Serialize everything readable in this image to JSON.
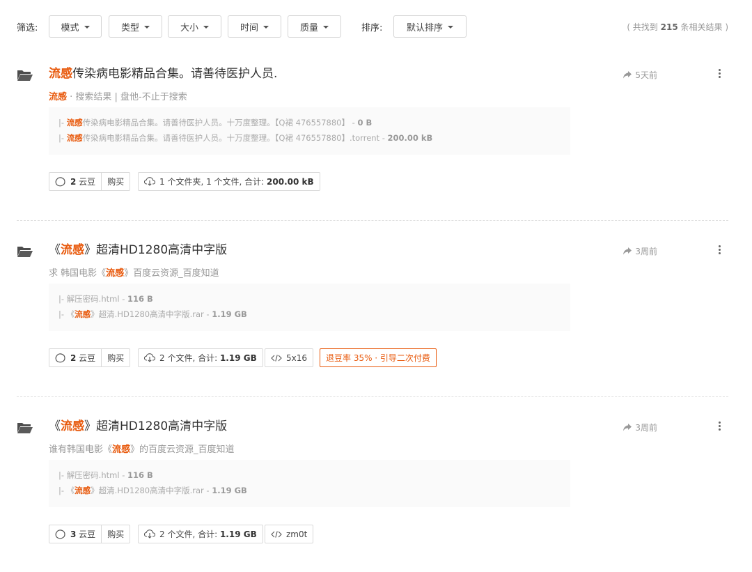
{
  "filter": {
    "label": "筛选:",
    "dropdowns": [
      "模式",
      "类型",
      "大小",
      "时间",
      "质量"
    ],
    "sort_label": "排序:",
    "sort_value": "默认排序",
    "count_prefix": "( 共找到 ",
    "count_value": "215",
    "count_suffix": " 条相关结果 )"
  },
  "results": [
    {
      "title_pre": "",
      "title_hl": "流感",
      "title_post": "传染病电影精品合集。请善待医护人员.",
      "time": "5天前",
      "sub_pre": "",
      "sub_hl": "流感",
      "sub_post": " · 搜索结果 | 盘他-不止于搜索",
      "files": [
        {
          "prefix": "|- ",
          "pre": "",
          "hl": "流感",
          "post": "传染病电影精品合集。请善待医护人员。十万度整理。【Q裙 476557880】 - ",
          "size": "0 B"
        },
        {
          "prefix": "|- ",
          "pre": "",
          "hl": "流感",
          "post": "传染病电影精品合集。请善待医护人员。十万度整理。【Q裙 476557880】.torrent - ",
          "size": "200.00 kB"
        }
      ],
      "beans": "2",
      "bean_unit": " 云豆",
      "buy": "购买",
      "info_pre": "1 个文件夹, 1 个文件, 合计: ",
      "info_size": "200.00 kB",
      "code": "",
      "refund": ""
    },
    {
      "title_pre": "《",
      "title_hl": "流感",
      "title_post": "》超清HD1280高清中字版",
      "time": "3周前",
      "sub_pre": "求 韩国电影《",
      "sub_hl": "流感",
      "sub_post": "》百度云资源_百度知道",
      "files": [
        {
          "prefix": "|- ",
          "pre": "解压密码.html - ",
          "hl": "",
          "post": "",
          "size": "116 B"
        },
        {
          "prefix": "|- ",
          "pre": "《",
          "hl": "流感",
          "post": "》超清.HD1280高清中字版.rar - ",
          "size": "1.19 GB"
        }
      ],
      "beans": "2",
      "bean_unit": " 云豆",
      "buy": "购买",
      "info_pre": "2 个文件, 合计: ",
      "info_size": "1.19 GB",
      "code": "5x16",
      "refund": "退豆率 35% · 引导二次付费"
    },
    {
      "title_pre": "《",
      "title_hl": "流感",
      "title_post": "》超清HD1280高清中字版",
      "time": "3周前",
      "sub_pre": "谁有韩国电影《",
      "sub_hl": "流感",
      "sub_post": "》的百度云资源_百度知道",
      "files": [
        {
          "prefix": "|- ",
          "pre": "解压密码.html - ",
          "hl": "",
          "post": "",
          "size": "116 B"
        },
        {
          "prefix": "|- ",
          "pre": "《",
          "hl": "流感",
          "post": "》超清.HD1280高清中字版.rar - ",
          "size": "1.19 GB"
        }
      ],
      "beans": "3",
      "bean_unit": " 云豆",
      "buy": "购买",
      "info_pre": "2 个文件, 合计: ",
      "info_size": "1.19 GB",
      "code": "zm0t",
      "refund": ""
    }
  ]
}
